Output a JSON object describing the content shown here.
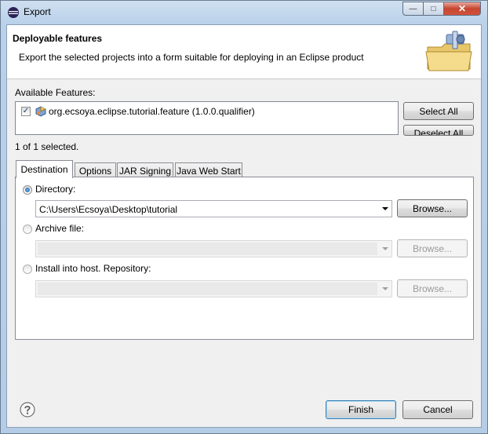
{
  "window": {
    "title": "Export",
    "min_glyph": "—",
    "max_glyph": "□",
    "close_glyph": "✕"
  },
  "header": {
    "title": "Deployable features",
    "description": "Export the selected projects into a form suitable for deploying in an Eclipse product"
  },
  "features": {
    "label": "Available Features:",
    "items": [
      {
        "label": "org.ecsoya.eclipse.tutorial.feature (1.0.0.qualifier)",
        "checked": true
      }
    ],
    "select_all": "Select All",
    "deselect_all": "Deselect All",
    "status": "1 of 1 selected."
  },
  "tabs": [
    "Destination",
    "Options",
    "JAR Signing",
    "Java Web Start"
  ],
  "destination": {
    "directory_label": "Directory:",
    "directory_value": "C:\\Users\\Ecsoya\\Desktop\\tutorial",
    "archive_label": "Archive file:",
    "repository_label": "Install into host. Repository:",
    "browse": "Browse..."
  },
  "footer": {
    "finish": "Finish",
    "cancel": "Cancel"
  }
}
